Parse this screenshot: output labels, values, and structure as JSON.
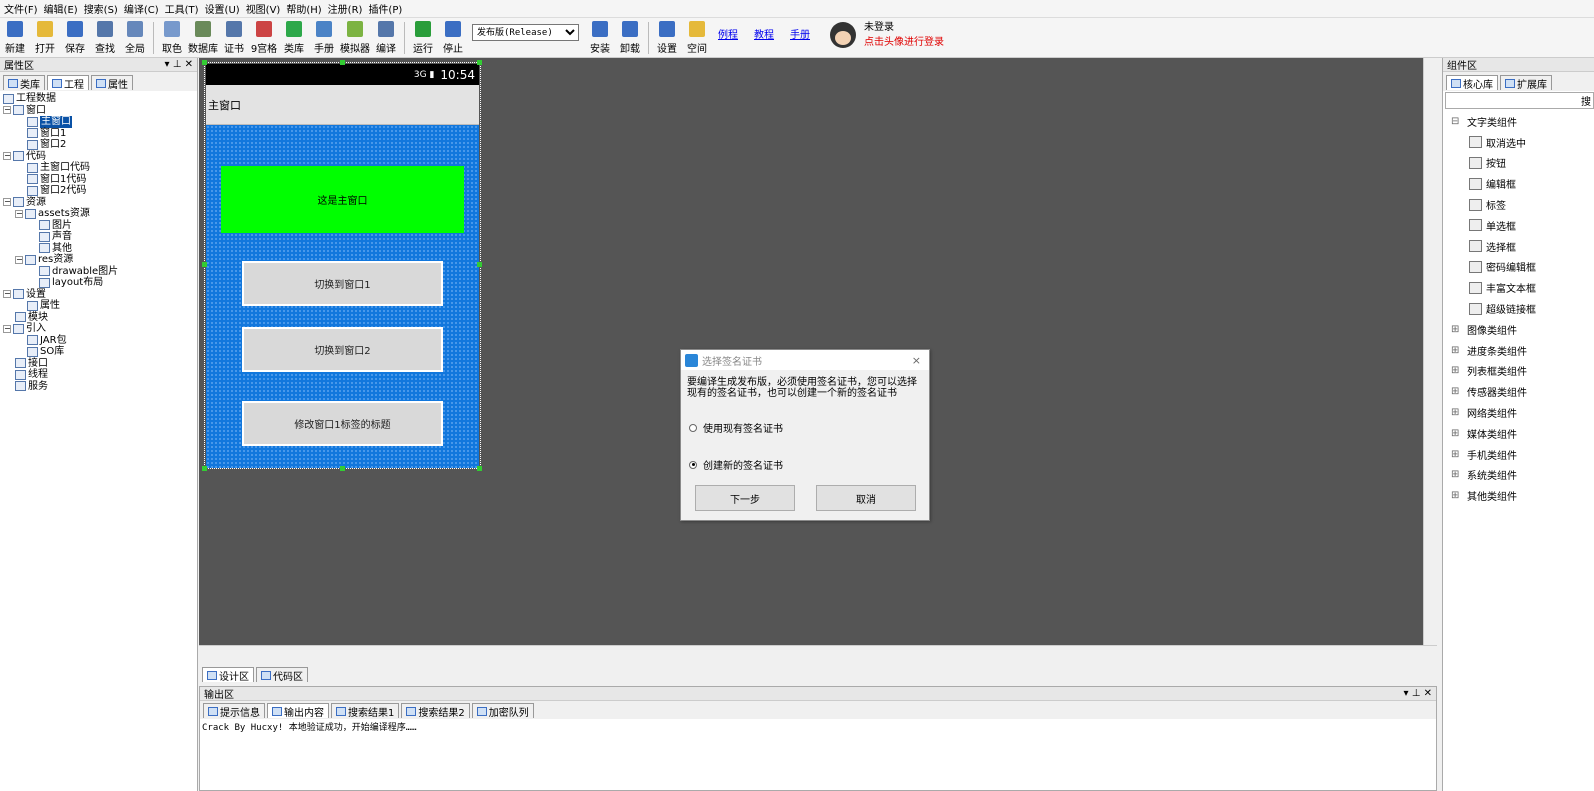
{
  "menu": [
    "文件(F)",
    "编辑(E)",
    "搜索(S)",
    "编译(C)",
    "工具(T)",
    "设置(U)",
    "视图(V)",
    "帮助(H)",
    "注册(R)",
    "插件(P)"
  ],
  "toolbar": {
    "items": [
      {
        "label": "新建",
        "icon": "new-file-icon",
        "color": "#3b6ec3"
      },
      {
        "label": "打开",
        "icon": "open-folder-icon",
        "color": "#e5b93a"
      },
      {
        "label": "保存",
        "icon": "save-icon",
        "color": "#3b6ec3"
      },
      {
        "label": "查找",
        "icon": "search-icon",
        "color": "#5577aa"
      },
      {
        "label": "全局",
        "icon": "fullscreen-icon",
        "color": "#6688bb"
      },
      {
        "label": "取色",
        "icon": "color-picker-icon",
        "color": "#7799cc"
      },
      {
        "label": "数据库",
        "icon": "database-icon",
        "color": "#6a8a5a"
      },
      {
        "label": "证书",
        "icon": "certificate-icon",
        "color": "#5577aa"
      },
      {
        "label": "9宫格",
        "icon": "grid-icon",
        "color": "#cc4444"
      },
      {
        "label": "类库",
        "icon": "library-icon",
        "color": "#2da84a"
      },
      {
        "label": "手册",
        "icon": "manual-icon",
        "color": "#4b83c6"
      },
      {
        "label": "模拟器",
        "icon": "android-icon",
        "color": "#7cb342"
      },
      {
        "label": "编译",
        "icon": "compile-icon",
        "color": "#5577aa"
      },
      {
        "label": "运行",
        "icon": "run-icon",
        "color": "#2a9d3a"
      },
      {
        "label": "停止",
        "icon": "stop-icon",
        "color": "#3b6ec3"
      },
      {
        "label": "安装",
        "icon": "install-icon",
        "color": "#3b6ec3"
      },
      {
        "label": "卸载",
        "icon": "uninstall-icon",
        "color": "#3b6ec3"
      },
      {
        "label": "设置",
        "icon": "info-icon",
        "color": "#3b6ec3"
      },
      {
        "label": "空间",
        "icon": "folder-icon",
        "color": "#e5b93a"
      }
    ],
    "build_mode": "发布版(Release)",
    "links": [
      "例程",
      "教程",
      "手册"
    ],
    "login_status": "未登录",
    "login_hint": "点击头像进行登录"
  },
  "left_panel": {
    "title": "属性区",
    "controls": "▾ ⊥ ✕",
    "tabs": [
      "类库",
      "工程",
      "属性"
    ],
    "tree": [
      {
        "label": "工程数据",
        "indent": 0,
        "exp": ""
      },
      {
        "label": "窗口",
        "indent": 0,
        "exp": "−"
      },
      {
        "label": "主窗口",
        "indent": 2,
        "exp": "",
        "selected": true
      },
      {
        "label": "窗口1",
        "indent": 2,
        "exp": ""
      },
      {
        "label": "窗口2",
        "indent": 2,
        "exp": ""
      },
      {
        "label": "代码",
        "indent": 0,
        "exp": "−"
      },
      {
        "label": "主窗口代码",
        "indent": 2,
        "exp": ""
      },
      {
        "label": "窗口1代码",
        "indent": 2,
        "exp": ""
      },
      {
        "label": "窗口2代码",
        "indent": 2,
        "exp": ""
      },
      {
        "label": "资源",
        "indent": 0,
        "exp": "−"
      },
      {
        "label": "assets资源",
        "indent": 1,
        "exp": "−"
      },
      {
        "label": "图片",
        "indent": 3,
        "exp": ""
      },
      {
        "label": "声音",
        "indent": 3,
        "exp": ""
      },
      {
        "label": "其他",
        "indent": 3,
        "exp": ""
      },
      {
        "label": "res资源",
        "indent": 1,
        "exp": "−"
      },
      {
        "label": "drawable图片",
        "indent": 3,
        "exp": ""
      },
      {
        "label": "layout布局",
        "indent": 3,
        "exp": ""
      },
      {
        "label": "设置",
        "indent": 0,
        "exp": "−"
      },
      {
        "label": "属性",
        "indent": 2,
        "exp": ""
      },
      {
        "label": "模块",
        "indent": 1,
        "exp": ""
      },
      {
        "label": "引入",
        "indent": 0,
        "exp": "−"
      },
      {
        "label": "JAR包",
        "indent": 2,
        "exp": ""
      },
      {
        "label": "SO库",
        "indent": 2,
        "exp": ""
      },
      {
        "label": "接口",
        "indent": 1,
        "exp": ""
      },
      {
        "label": "线程",
        "indent": 1,
        "exp": ""
      },
      {
        "label": "服务",
        "indent": 1,
        "exp": ""
      }
    ]
  },
  "phone": {
    "time": "10:54",
    "signal": "3G ▮",
    "window_title": "主窗口",
    "label_text": "这是主窗口",
    "buttons": [
      "切换到窗口1",
      "切换到窗口2",
      "修改窗口1标签的标题"
    ]
  },
  "dialog": {
    "title": "选择签名证书",
    "close": "×",
    "message": "要编译生成发布版，必须使用签名证书，您可以选择现有的签名证书，也可以创建一个新的签名证书",
    "options": [
      "使用现有签名证书",
      "创建新的签名证书"
    ],
    "selected_option": 1,
    "next": "下一步",
    "cancel": "取消"
  },
  "bottom_tabs": [
    "设计区",
    "代码区"
  ],
  "output": {
    "title": "输出区",
    "controls": "▾ ⊥ ✕",
    "tabs": [
      "提示信息",
      "输出内容",
      "搜索结果1",
      "搜索结果2",
      "加密队列"
    ],
    "text": "Crack By Hucxy! 本地验证成功，开始编译程序……"
  },
  "right_panel": {
    "title": "组件区",
    "tabs": [
      "核心库",
      "扩展库"
    ],
    "search_label": "搜",
    "group_open": "文字类组件",
    "components": [
      {
        "label": "取消选中",
        "icon": "cursor-icon"
      },
      {
        "label": "按钮",
        "icon": "button-icon"
      },
      {
        "label": "编辑框",
        "icon": "textbox-icon"
      },
      {
        "label": "标签",
        "icon": "label-icon"
      },
      {
        "label": "单选框",
        "icon": "radio-icon"
      },
      {
        "label": "选择框",
        "icon": "checkbox-icon"
      },
      {
        "label": "密码编辑框",
        "icon": "password-icon"
      },
      {
        "label": "丰富文本框",
        "icon": "richtext-icon"
      },
      {
        "label": "超级链接框",
        "icon": "hyperlink-icon"
      }
    ],
    "groups": [
      "图像类组件",
      "进度条类组件",
      "列表框类组件",
      "传感器类组件",
      "网络类组件",
      "媒体类组件",
      "手机类组件",
      "系统类组件",
      "其他类组件"
    ]
  }
}
